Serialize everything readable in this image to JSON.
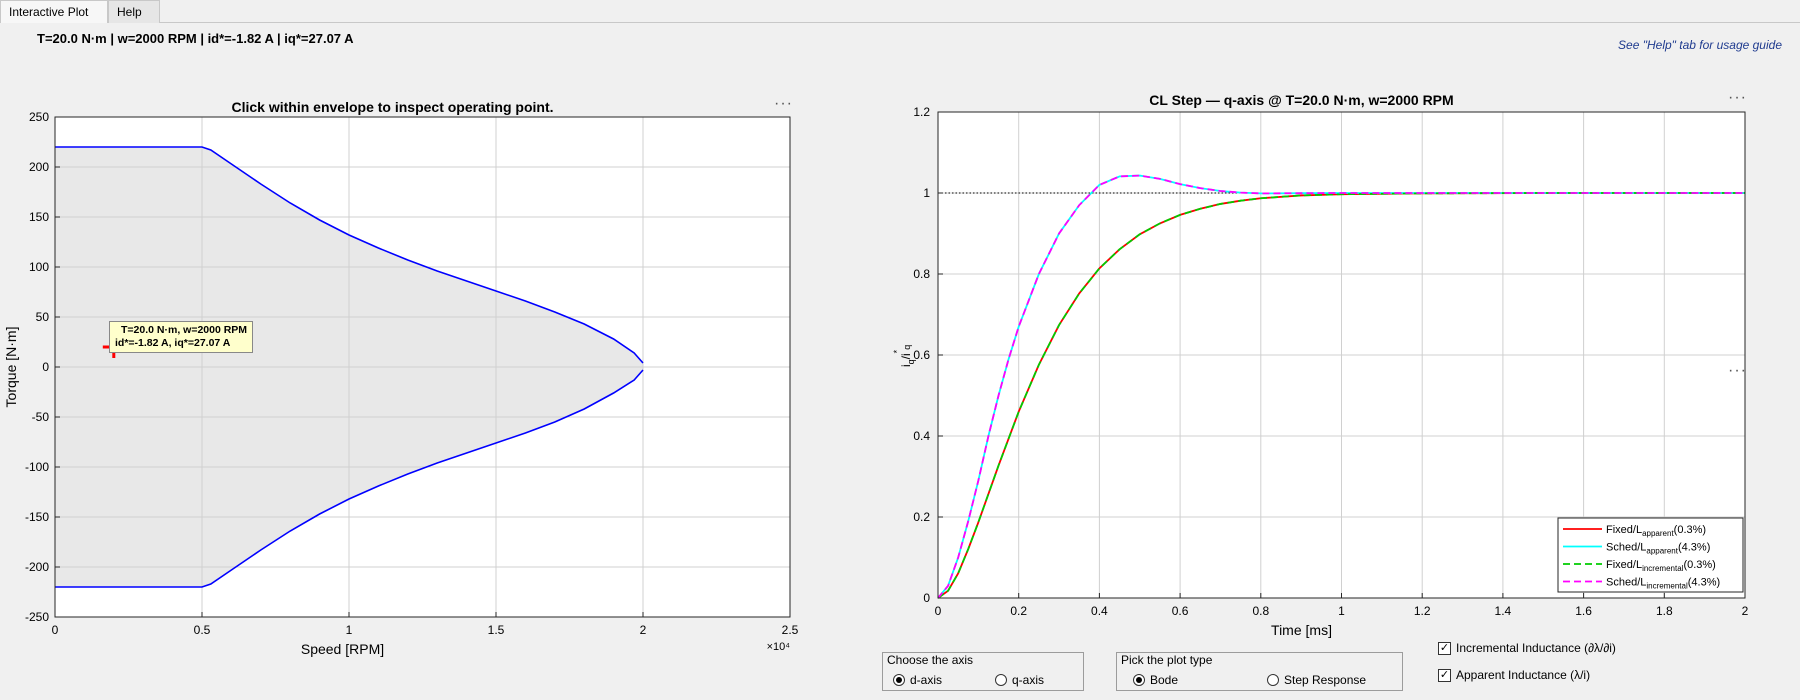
{
  "tabs": [
    {
      "label": "Interactive Plot"
    },
    {
      "label": "Help"
    }
  ],
  "status": "T=20.0 N·m  |  w=2000 RPM  |  id*=-1.82 A  |  iq*=27.07 A",
  "help_hint": "See \"Help\" tab for usage guide",
  "colors": {
    "envelope": "#0000ff",
    "fixed_apparent": "#ff0000",
    "sched_apparent": "#00ffff",
    "fixed_incremental": "#00cc00",
    "sched_incremental": "#ff00ff",
    "marker": "#ff0000"
  },
  "left_panel": {
    "more": "···",
    "tooltip": {
      "line1": "T=20.0 N·m, w=2000 RPM",
      "line2": "id*=-1.82 A, iq*=27.07 A"
    }
  },
  "right_panel": {
    "more": "···",
    "side_more": "···"
  },
  "chart_data": [
    {
      "type": "area",
      "title": "Click within envelope to inspect operating point.",
      "xlabel": "Speed [RPM]",
      "ylabel": "Torque [N·m]",
      "x_exponent_label": "×10⁴",
      "xlim": [
        0,
        25000
      ],
      "ylim": [
        -250,
        250
      ],
      "xticks": [
        0,
        5000,
        10000,
        15000,
        20000,
        25000
      ],
      "xtick_labels": [
        "0",
        "0.5",
        "1",
        "1.5",
        "2",
        "2.5"
      ],
      "yticks": [
        -250,
        -200,
        -150,
        -100,
        -50,
        0,
        50,
        100,
        150,
        200,
        250
      ],
      "grid": true,
      "envelope_upper": [
        [
          0,
          220
        ],
        [
          5000,
          220
        ],
        [
          5300,
          217
        ],
        [
          6000,
          203
        ],
        [
          7000,
          183
        ],
        [
          8000,
          164
        ],
        [
          9000,
          147
        ],
        [
          10000,
          132
        ],
        [
          11000,
          119
        ],
        [
          12000,
          107
        ],
        [
          13000,
          96
        ],
        [
          14000,
          86
        ],
        [
          15000,
          76
        ],
        [
          16000,
          66
        ],
        [
          17000,
          55
        ],
        [
          18000,
          43
        ],
        [
          19000,
          28
        ],
        [
          19700,
          14
        ],
        [
          20000,
          4
        ]
      ],
      "envelope_lower": [
        [
          20000,
          -3
        ],
        [
          19700,
          -13
        ],
        [
          19000,
          -26
        ],
        [
          18000,
          -42
        ],
        [
          17000,
          -55
        ],
        [
          16000,
          -66
        ],
        [
          15000,
          -76
        ],
        [
          14000,
          -86
        ],
        [
          13000,
          -96
        ],
        [
          12000,
          -107
        ],
        [
          11000,
          -119
        ],
        [
          10000,
          -132
        ],
        [
          9000,
          -147
        ],
        [
          8000,
          -164
        ],
        [
          7000,
          -183
        ],
        [
          6000,
          -203
        ],
        [
          5300,
          -217
        ],
        [
          5000,
          -220
        ],
        [
          0,
          -220
        ]
      ],
      "operating_point": {
        "speed": 2000,
        "torque": 20
      }
    },
    {
      "type": "line",
      "title": "CL Step — q-axis @ T=20.0 N·m, w=2000 RPM",
      "xlabel": "Time [ms]",
      "ylabel_main": "i",
      "ylabel_sub": "q",
      "ylabel_sep": "/i",
      "ylabel_sup": "*",
      "xlim": [
        0,
        2
      ],
      "ylim": [
        0,
        1.2
      ],
      "xticks": [
        0,
        0.2,
        0.4,
        0.6,
        0.8,
        1,
        1.2,
        1.4,
        1.6,
        1.8,
        2
      ],
      "yticks": [
        0,
        0.2,
        0.4,
        0.6,
        0.8,
        1,
        1.2
      ],
      "reference": 1,
      "grid": true,
      "legend_position": "bottom-right",
      "series": [
        {
          "name": "Fixed/L",
          "sub": "apparent",
          "suffix": "(0.3%)",
          "color": "#ff0000",
          "dash": false,
          "points": [
            [
              0,
              0
            ],
            [
              0.025,
              0.018
            ],
            [
              0.05,
              0.061
            ],
            [
              0.075,
              0.121
            ],
            [
              0.1,
              0.187
            ],
            [
              0.15,
              0.327
            ],
            [
              0.2,
              0.46
            ],
            [
              0.25,
              0.576
            ],
            [
              0.3,
              0.674
            ],
            [
              0.35,
              0.752
            ],
            [
              0.4,
              0.814
            ],
            [
              0.45,
              0.861
            ],
            [
              0.5,
              0.898
            ],
            [
              0.55,
              0.925
            ],
            [
              0.6,
              0.946
            ],
            [
              0.65,
              0.961
            ],
            [
              0.7,
              0.973
            ],
            [
              0.75,
              0.981
            ],
            [
              0.8,
              0.987
            ],
            [
              0.9,
              0.994
            ],
            [
              1.0,
              0.997
            ],
            [
              1.2,
              0.999
            ],
            [
              1.5,
              1.0
            ],
            [
              2.0,
              1.0
            ]
          ]
        },
        {
          "name": "Sched/L",
          "sub": "apparent",
          "suffix": "(4.3%)",
          "color": "#00ffff",
          "dash": false,
          "points": [
            [
              0,
              0
            ],
            [
              0.025,
              0.03
            ],
            [
              0.05,
              0.1
            ],
            [
              0.075,
              0.19
            ],
            [
              0.1,
              0.29
            ],
            [
              0.125,
              0.4
            ],
            [
              0.15,
              0.5
            ],
            [
              0.175,
              0.59
            ],
            [
              0.2,
              0.67
            ],
            [
              0.25,
              0.8
            ],
            [
              0.3,
              0.9
            ],
            [
              0.35,
              0.97
            ],
            [
              0.4,
              1.02
            ],
            [
              0.45,
              1.041
            ],
            [
              0.5,
              1.043
            ],
            [
              0.55,
              1.035
            ],
            [
              0.6,
              1.022
            ],
            [
              0.65,
              1.012
            ],
            [
              0.7,
              1.005
            ],
            [
              0.75,
              1.001
            ],
            [
              0.8,
              0.999
            ],
            [
              0.9,
              0.9995
            ],
            [
              1.0,
              1.0
            ],
            [
              2.0,
              1.0
            ]
          ]
        },
        {
          "name": "Fixed/L",
          "sub": "incremental",
          "suffix": "(0.3%)",
          "color": "#00cc00",
          "dash": true,
          "points": [
            [
              0,
              0
            ],
            [
              0.025,
              0.018
            ],
            [
              0.05,
              0.061
            ],
            [
              0.075,
              0.121
            ],
            [
              0.1,
              0.187
            ],
            [
              0.15,
              0.327
            ],
            [
              0.2,
              0.46
            ],
            [
              0.25,
              0.576
            ],
            [
              0.3,
              0.674
            ],
            [
              0.35,
              0.752
            ],
            [
              0.4,
              0.814
            ],
            [
              0.45,
              0.861
            ],
            [
              0.5,
              0.898
            ],
            [
              0.55,
              0.925
            ],
            [
              0.6,
              0.946
            ],
            [
              0.65,
              0.961
            ],
            [
              0.7,
              0.973
            ],
            [
              0.75,
              0.981
            ],
            [
              0.8,
              0.987
            ],
            [
              0.9,
              0.994
            ],
            [
              1.0,
              0.997
            ],
            [
              1.2,
              0.999
            ],
            [
              1.5,
              1.0
            ],
            [
              2.0,
              1.0
            ]
          ]
        },
        {
          "name": "Sched/L",
          "sub": "incremental",
          "suffix": "(4.3%)",
          "color": "#ff00ff",
          "dash": true,
          "points": [
            [
              0,
              0
            ],
            [
              0.025,
              0.03
            ],
            [
              0.05,
              0.1
            ],
            [
              0.075,
              0.19
            ],
            [
              0.1,
              0.29
            ],
            [
              0.125,
              0.4
            ],
            [
              0.15,
              0.5
            ],
            [
              0.175,
              0.59
            ],
            [
              0.2,
              0.67
            ],
            [
              0.25,
              0.8
            ],
            [
              0.3,
              0.9
            ],
            [
              0.35,
              0.97
            ],
            [
              0.4,
              1.02
            ],
            [
              0.45,
              1.041
            ],
            [
              0.5,
              1.043
            ],
            [
              0.55,
              1.035
            ],
            [
              0.6,
              1.022
            ],
            [
              0.65,
              1.012
            ],
            [
              0.7,
              1.005
            ],
            [
              0.75,
              1.001
            ],
            [
              0.8,
              0.999
            ],
            [
              0.9,
              0.9995
            ],
            [
              1.0,
              1.0
            ],
            [
              2.0,
              1.0
            ]
          ]
        }
      ]
    }
  ],
  "controls": {
    "axis_group": {
      "label": "Choose the axis",
      "options": [
        {
          "label": "d-axis",
          "selected": true
        },
        {
          "label": "q-axis",
          "selected": false
        }
      ]
    },
    "plot_group": {
      "label": "Pick the plot type",
      "options": [
        {
          "label": "Bode",
          "selected": true
        },
        {
          "label": "Step Response",
          "selected": false
        }
      ]
    },
    "checks": [
      {
        "label": "Incremental Inductance (∂λ/∂i)",
        "checked": true
      },
      {
        "label": "Apparent Inductance (λ/i)",
        "checked": true
      }
    ]
  }
}
